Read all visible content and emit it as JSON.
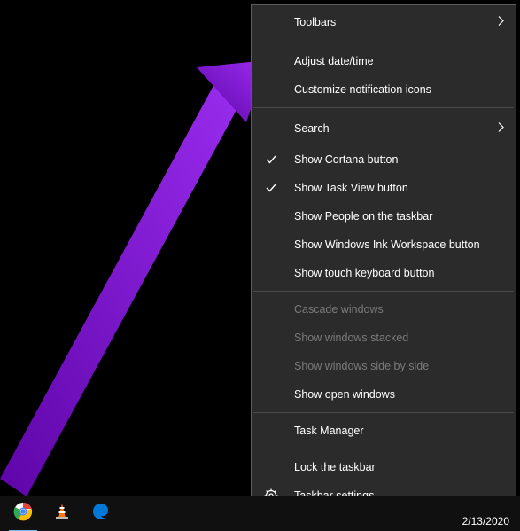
{
  "menu": {
    "toolbars": "Toolbars",
    "adjust_datetime": "Adjust date/time",
    "customize_notification": "Customize notification icons",
    "search": "Search",
    "show_cortana": "Show Cortana button",
    "show_task_view": "Show Task View button",
    "show_people": "Show People on the taskbar",
    "show_ink": "Show Windows Ink Workspace button",
    "show_touch_kb": "Show touch keyboard button",
    "cascade": "Cascade windows",
    "stacked": "Show windows stacked",
    "side_by_side": "Show windows side by side",
    "show_open": "Show open windows",
    "task_manager": "Task Manager",
    "lock_taskbar": "Lock the taskbar",
    "taskbar_settings": "Taskbar settings"
  },
  "systray": {
    "date": "2/13/2020"
  },
  "icons": {
    "chrome": "chrome-icon",
    "vlc": "vlc-icon",
    "edge": "edge-icon",
    "gear": "gear-icon",
    "check": "check-icon",
    "chevron_right": "chevron-right-icon"
  },
  "annotation": {
    "arrow_color": "#7a0bcf",
    "target": "adjust_datetime"
  },
  "checked": {
    "show_cortana": true,
    "show_task_view": true
  }
}
